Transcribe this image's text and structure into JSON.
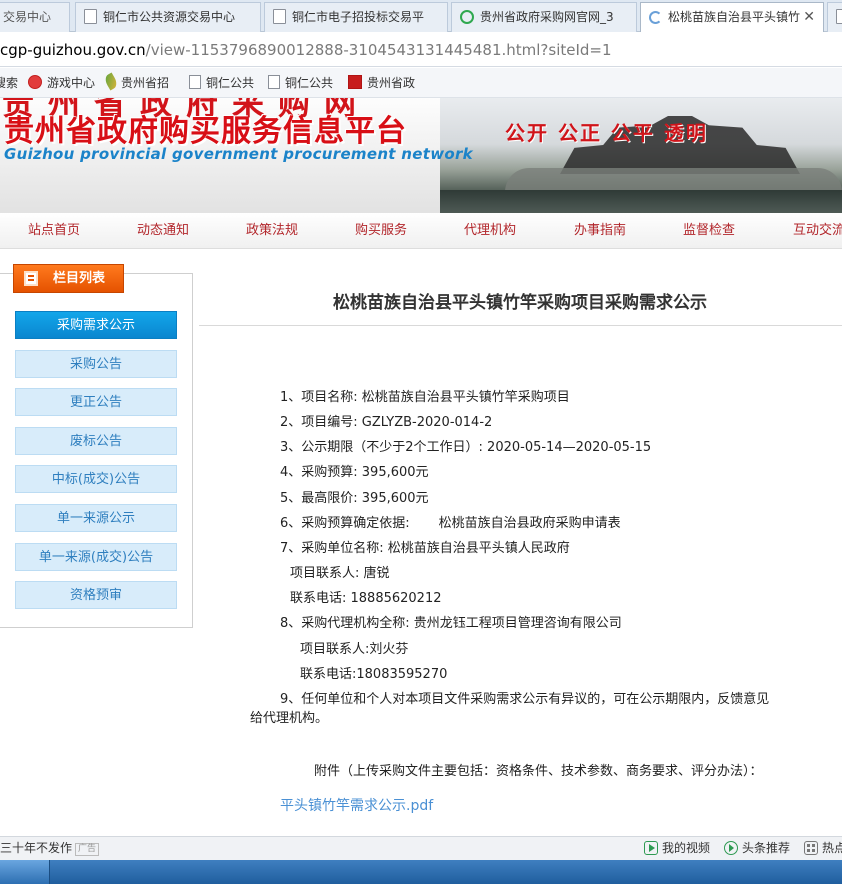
{
  "browser": {
    "tabs": [
      {
        "title": "交易中心",
        "icon": "page-icon",
        "active": false
      },
      {
        "title": "铜仁市公共资源交易中心",
        "icon": "page-icon",
        "active": false
      },
      {
        "title": "铜仁市电子招投标交易平",
        "icon": "page-icon",
        "active": false
      },
      {
        "title": "贵州省政府采购网官网_3",
        "icon": "search-engine-icon",
        "active": false
      },
      {
        "title": "松桃苗族自治县平头镇竹",
        "icon": "loading-icon",
        "active": true
      }
    ],
    "tab_close": "✕",
    "address": {
      "host": "cgp-guizhou.gov.cn",
      "path": "/view-1153796890012888-3104543131445481.html?siteId=1"
    },
    "bookmarks": [
      {
        "label": "搜索",
        "icon": "none"
      },
      {
        "label": "游戏中心",
        "icon": "game-icon"
      },
      {
        "label": "贵州省招",
        "icon": "feather-icon"
      },
      {
        "label": "铜仁公共",
        "icon": "page-icon"
      },
      {
        "label": "铜仁公共",
        "icon": "page-icon"
      },
      {
        "label": "贵州省政",
        "icon": "red-seal-icon"
      }
    ]
  },
  "site": {
    "title_top": "贵州省政府采购网",
    "title_main": "贵州省政府购买服务信息平台",
    "title_en": "Guizhou provincial government procurement network",
    "slogan": "公开 公正 公平 透明",
    "nav": [
      "站点首页",
      "动态通知",
      "政策法规",
      "购买服务",
      "代理机构",
      "办事指南",
      "监督检查",
      "互动交流"
    ]
  },
  "sidebar": {
    "heading": "栏目列表",
    "items": [
      {
        "label": "采购需求公示",
        "active": true
      },
      {
        "label": "采购公告",
        "active": false
      },
      {
        "label": "更正公告",
        "active": false
      },
      {
        "label": "废标公告",
        "active": false
      },
      {
        "label": "中标(成交)公告",
        "active": false
      },
      {
        "label": "单一来源公示",
        "active": false
      },
      {
        "label": "单一来源(成交)公告",
        "active": false
      },
      {
        "label": "资格预审",
        "active": false
      }
    ]
  },
  "article": {
    "title": "松桃苗族自治县平头镇竹竿采购项目采购需求公示",
    "lines": [
      "1、项目名称: 松桃苗族自治县平头镇竹竿采购项目",
      "2、项目编号: GZLYZB-2020-014-2",
      "3、公示期限（不少于2个工作日）: 2020-05-14—2020-05-15",
      "4、采购预算: 395,600元",
      "5、最高限价: 395,600元",
      "6、采购预算确定依据:       松桃苗族自治县政府采购申请表",
      "7、采购单位名称: 松桃苗族自治县平头镇人民政府",
      "项目联系人: 唐锐",
      "联系电话: 18885620212",
      "8、采购代理机构全称: 贵州龙钰工程项目管理咨询有限公司",
      "项目联系人:刘火芬",
      "联系电话:18083595270",
      "9、任何单位和个人对本项目文件采购需求公示有异议的，可在公示期限内，反馈意见",
      "给代理机构。",
      "附件（上传采购文件主要包括：资格条件、技术参数、商务要求、评分办法）："
    ],
    "attachment": "平头镇竹竿需求公示.pdf"
  },
  "statusbar": {
    "left_text": "三十年不发作",
    "left_badge": "广告",
    "items": [
      {
        "label": "我的视频",
        "icon": "video-icon"
      },
      {
        "label": "头条推荐",
        "icon": "play-circle-icon"
      },
      {
        "label": "热点",
        "icon": "grid-icon"
      }
    ]
  }
}
